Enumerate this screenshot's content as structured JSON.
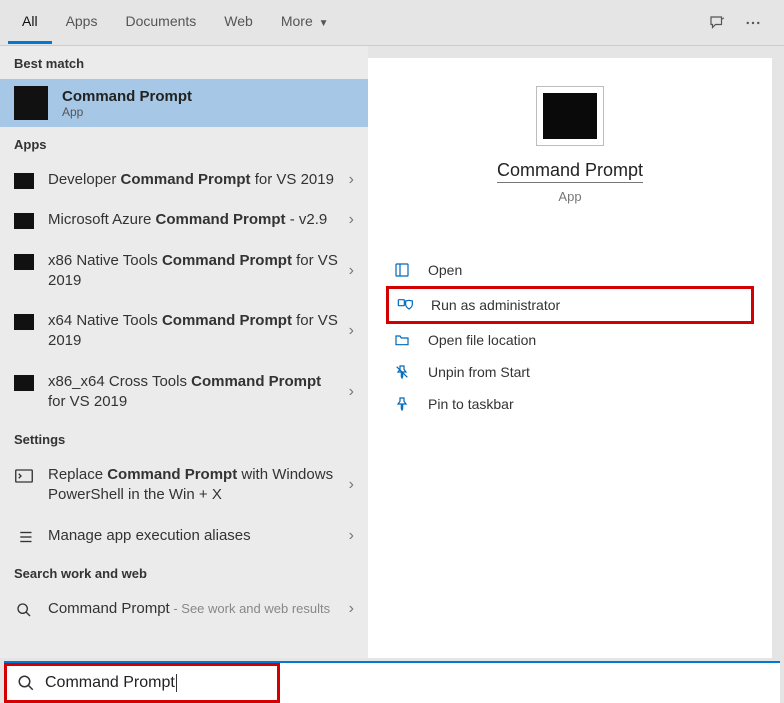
{
  "topbar": {
    "tabs": {
      "all": "All",
      "apps": "Apps",
      "documents": "Documents",
      "web": "Web",
      "more": "More"
    }
  },
  "sections": {
    "best_match": "Best match",
    "apps": "Apps",
    "settings": "Settings",
    "search_work_web": "Search work and web"
  },
  "best_match": {
    "title": "Command Prompt",
    "subtitle": "App"
  },
  "apps_results": {
    "r0": {
      "pre": "Developer ",
      "bold": "Command Prompt",
      "post": " for VS 2019"
    },
    "r1": {
      "pre": "Microsoft Azure ",
      "bold": "Command Prompt",
      "post": " - v2.9"
    },
    "r2": {
      "pre": "x86 Native Tools ",
      "bold": "Command Prompt",
      "post": " for VS 2019"
    },
    "r3": {
      "pre": "x64 Native Tools ",
      "bold": "Command Prompt",
      "post": " for VS 2019"
    },
    "r4": {
      "pre": "x86_x64 Cross Tools ",
      "bold": "Command Prompt",
      "post": " for VS 2019"
    }
  },
  "settings_results": {
    "s0": {
      "pre": "Replace ",
      "bold": "Command Prompt",
      "post": " with Windows PowerShell in the Win + X"
    },
    "s1": {
      "text": "Manage app execution aliases"
    }
  },
  "web_results": {
    "w0": {
      "text": "Command Prompt",
      "hint": " - See work and web results"
    }
  },
  "detail": {
    "title": "Command Prompt",
    "subtitle": "App",
    "actions": {
      "open": "Open",
      "run_admin": "Run as administrator",
      "open_loc": "Open file location",
      "unpin": "Unpin from Start",
      "pin_taskbar": "Pin to taskbar"
    }
  },
  "search": {
    "query": "Command Prompt"
  }
}
